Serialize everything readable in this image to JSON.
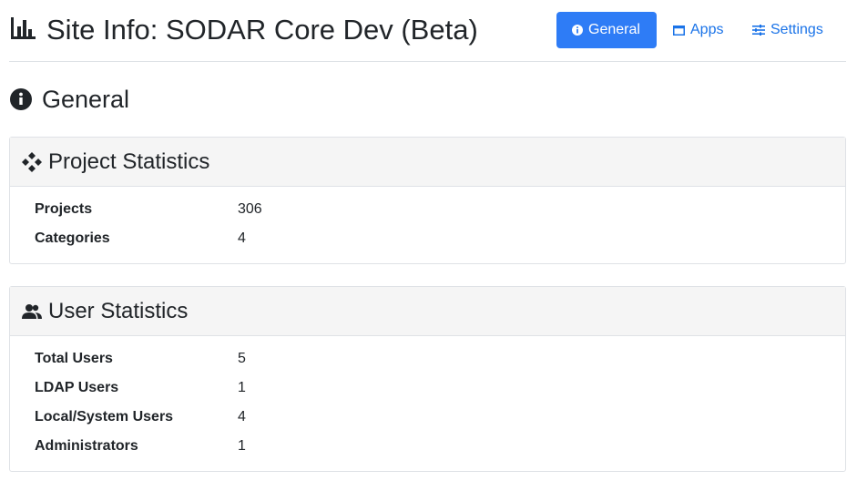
{
  "header": {
    "title": "Site Info: SODAR Core Dev (Beta)",
    "icon": "bar-chart-icon"
  },
  "nav": {
    "general_label": "General",
    "apps_label": "Apps",
    "settings_label": "Settings",
    "active": "General",
    "accent_color": "#2e7cf6",
    "link_color": "#1a73e8"
  },
  "section": {
    "title": "General",
    "icon": "info-circle-icon"
  },
  "project_stats": {
    "title": "Project Statistics",
    "icon": "diamonds-icon",
    "rows": [
      {
        "label": "Projects",
        "value": "306"
      },
      {
        "label": "Categories",
        "value": "4"
      }
    ]
  },
  "user_stats": {
    "title": "User Statistics",
    "icon": "users-icon",
    "rows": [
      {
        "label": "Total Users",
        "value": "5"
      },
      {
        "label": "LDAP Users",
        "value": "1"
      },
      {
        "label": "Local/System Users",
        "value": "4"
      },
      {
        "label": "Administrators",
        "value": "1"
      }
    ]
  }
}
